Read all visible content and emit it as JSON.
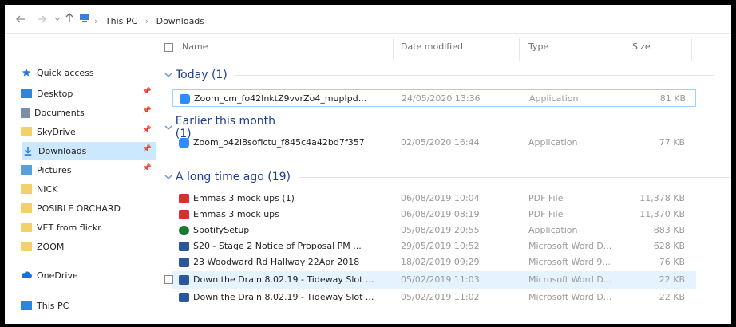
{
  "address": {
    "back_icon": "arrow-left-icon",
    "forward_icon": "arrow-right-icon",
    "recent_icon": "chevron-down-icon",
    "up_icon": "arrow-up-icon",
    "path": [
      "This PC",
      "Downloads"
    ]
  },
  "sidebar": {
    "items": [
      {
        "label": "Quick access",
        "icon": "star-icon",
        "color": "#2b7bd6"
      },
      {
        "label": "Desktop",
        "icon": "desktop-icon",
        "color": "#2f86d8",
        "pinned": true
      },
      {
        "label": "Documents",
        "icon": "documents-icon",
        "color": "#7a8fa8",
        "pinned": true
      },
      {
        "label": "SkyDrive",
        "icon": "folder-icon",
        "color": "#f3d06b",
        "pinned": true
      },
      {
        "label": "Downloads",
        "icon": "downloads-icon",
        "color": "#2f86d8",
        "pinned": true
      },
      {
        "label": "Pictures",
        "icon": "pictures-icon",
        "color": "#5aa0d8",
        "pinned": true
      },
      {
        "label": "NICK",
        "icon": "folder-icon",
        "color": "#f3d06b"
      },
      {
        "label": "POSIBLE ORCHARD",
        "icon": "folder-icon",
        "color": "#f3d06b"
      },
      {
        "label": "VET from flickr",
        "icon": "folder-icon",
        "color": "#f3d06b"
      },
      {
        "label": "ZOOM",
        "icon": "folder-icon",
        "color": "#f3d06b"
      },
      {
        "label": "OneDrive",
        "icon": "cloud-icon",
        "color": "#1d6fd1"
      },
      {
        "label": "This PC",
        "icon": "pc-icon",
        "color": "#2f86d8"
      }
    ]
  },
  "columns": {
    "name": "Name",
    "date": "Date modified",
    "type": "Type",
    "size": "Size"
  },
  "groups": [
    {
      "label": "Today (1)"
    },
    {
      "label": "Earlier this month (1)"
    },
    {
      "label": "A long time ago (19)"
    }
  ],
  "files": [
    {
      "name": "Zoom_cm_fo42InktZ9vvrZo4_mupIpd...",
      "date": "24/05/2020 13:36",
      "type": "Application",
      "size": "81 KB",
      "icon": "zoom-app-icon",
      "color": "#2d8cff"
    },
    {
      "name": "Zoom_o42l8sofictu_f845c4a42bd7f357",
      "date": "02/05/2020 16:44",
      "type": "Application",
      "size": "77 KB",
      "icon": "zoom-app-icon",
      "color": "#2d8cff"
    },
    {
      "name": "Emmas 3 mock ups (1)",
      "date": "06/08/2019 10:04",
      "type": "PDF File",
      "size": "11,378 KB",
      "icon": "pdf-icon",
      "color": "#d9302c"
    },
    {
      "name": "Emmas 3 mock ups",
      "date": "06/08/2019 08:19",
      "type": "PDF File",
      "size": "11,370 KB",
      "icon": "pdf-icon",
      "color": "#d9302c"
    },
    {
      "name": "SpotifySetup",
      "date": "05/08/2019 20:55",
      "type": "Application",
      "size": "883 KB",
      "icon": "spotify-icon",
      "color": "#1a7a2e"
    },
    {
      "name": "S20 - Stage 2 Notice of Proposal PM ...",
      "date": "29/05/2019 10:52",
      "type": "Microsoft Word D...",
      "size": "628 KB",
      "icon": "word-doc-icon",
      "color": "#2b579a"
    },
    {
      "name": "23 Woodward Rd Hallway 22Apr 2018",
      "date": "18/02/2019 09:29",
      "type": "Microsoft Word 9...",
      "size": "76 KB",
      "icon": "word-doc-icon",
      "color": "#2b579a"
    },
    {
      "name": "Down the Drain 8.02.19 - Tideway Slot ...",
      "date": "05/02/2019 11:03",
      "type": "Microsoft Word D...",
      "size": "22 KB",
      "icon": "word-doc-icon",
      "color": "#2b579a"
    },
    {
      "name": "Down the Drain 8.02.19 - Tideway Slot ...",
      "date": "05/02/2019 11:02",
      "type": "Microsoft Word D...",
      "size": "22 KB",
      "icon": "word-doc-icon",
      "color": "#2b579a"
    }
  ]
}
